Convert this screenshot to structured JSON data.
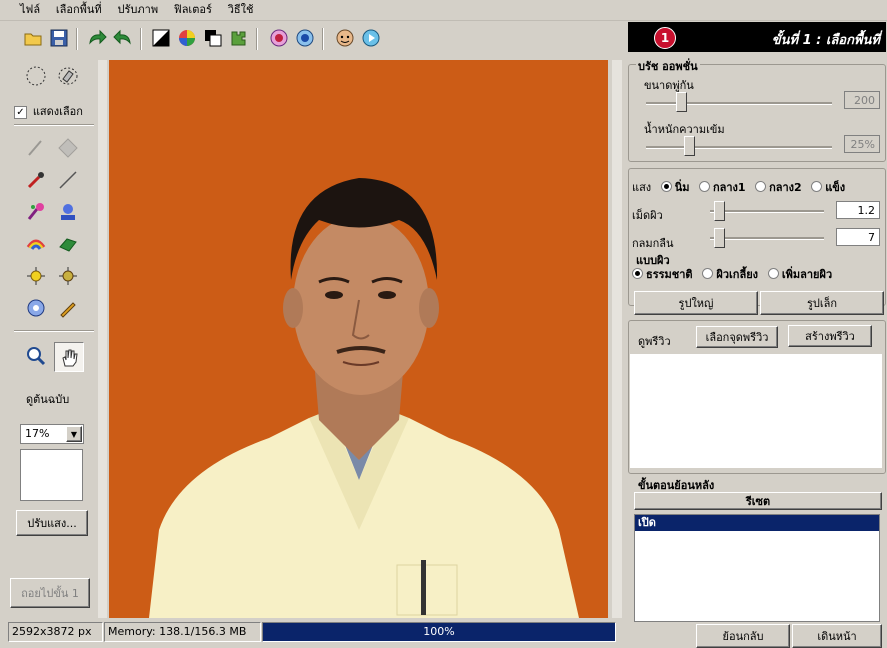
{
  "menu": {
    "items": [
      "ไฟล์",
      "เลือกพื้นที่",
      "ปรับภาพ",
      "ฟิลเตอร์",
      "วิธีใช้"
    ]
  },
  "toolbar": {
    "icons": [
      "open-folder-icon",
      "save-disk-icon",
      "redo-arrow-icon",
      "undo-arrow-icon",
      "contrast-icon",
      "color-wheel-icon",
      "layers-icon",
      "puzzle-icon",
      "color-red-circle-icon",
      "color-blue-circle-icon",
      "face-icon",
      "play-icon"
    ]
  },
  "left_panel": {
    "show_selection_label": "แสดงเลือก",
    "show_selection_checked": true,
    "view_original_label": "ดูต้นฉบับ",
    "zoom_value": "17%",
    "adjust_light_button": "ปรับแสง...",
    "next_step_button": "ถอยไปขั้น 1"
  },
  "status": {
    "dimensions": "2592x3872 px",
    "memory": "Memory: 138.1/156.3 MB",
    "progress": "100%"
  },
  "right_panel": {
    "step_number": "1",
    "step_title": "ขั้นที่ 1 : เลือกพื้นที่",
    "brush_group_label": "บรัช ออพชั่น",
    "brush_size_label": "ขนาดพู่กัน",
    "brush_size_value": "200",
    "brush_weight_label": "น้ำหนักความเข้ม",
    "brush_weight_value": "25%",
    "light_label": "แสง",
    "light_options": [
      "นิ่ม",
      "กลาง1",
      "กลาง2",
      "แข็ง"
    ],
    "light_selected": 0,
    "skin_label": "เม็ดผิว",
    "skin_value": "1.2",
    "blend_label": "กลมกลืน",
    "blend_value": "7",
    "skin_type_label": "แบบผิว",
    "skin_type_options": [
      "ธรรมชาติ",
      "ผิวเกลี้ยง",
      "เพิ่มลายผิว"
    ],
    "skin_type_selected": 0,
    "big_image_button": "รูปใหญ่",
    "small_image_button": "รูปเล็ก",
    "preview_label": "ดูพรีวิว",
    "select_preview_button": "เลือกจุดพรีวิว",
    "create_preview_button": "สร้างพรีวิว",
    "history_label": "ขั้นตอนย้อนหลัง",
    "reset_button": "รีเซต",
    "history_items": [
      "เปิด"
    ],
    "back_button": "ย้อนกลับ",
    "forward_button": "เดินหน้า"
  },
  "colors": {
    "photo_background": "#cc5c16",
    "selection_highlight": "#0a246a",
    "progress_bar": "#0a246a",
    "step_circle": "#c8102e"
  }
}
